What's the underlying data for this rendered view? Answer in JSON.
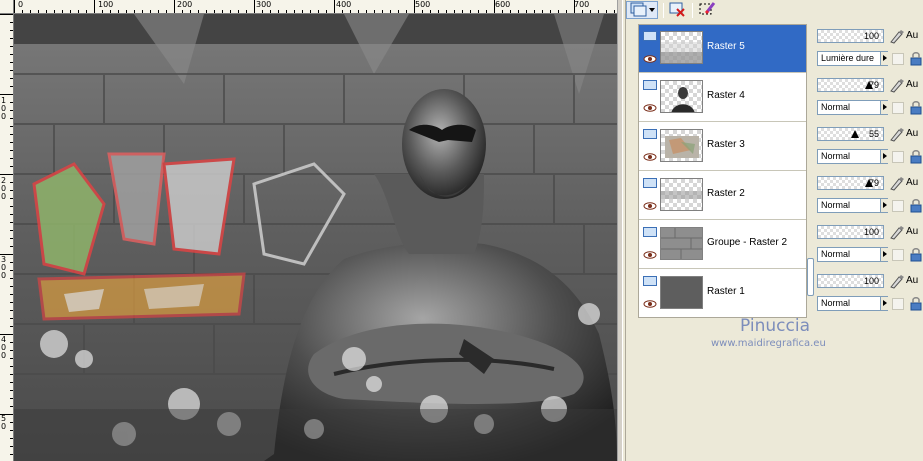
{
  "rulers": {
    "top_labels": [
      "0",
      "100",
      "200",
      "300",
      "400",
      "500",
      "600",
      "700"
    ],
    "left_labels": [
      "1\n0\n0",
      "2\n0\n0",
      "3\n0\n0",
      "4\n0\n0",
      "5\n0"
    ]
  },
  "toolbar": {
    "new_icon": "new-layer-icon",
    "delete_icon": "delete-layer-icon",
    "edit_icon": "edit-selection-icon"
  },
  "layers": [
    {
      "name": "Raster 5",
      "selected": true,
      "opacity": "100",
      "blend": "Lumière dure",
      "au": "Au"
    },
    {
      "name": "Raster 4",
      "selected": false,
      "opacity": "79",
      "blend": "Normal",
      "au": "Au"
    },
    {
      "name": "Raster 3",
      "selected": false,
      "opacity": "55",
      "blend": "Normal",
      "au": "Au"
    },
    {
      "name": "Raster 2",
      "selected": false,
      "opacity": "79",
      "blend": "Normal",
      "au": "Au"
    },
    {
      "name": "Groupe - Raster 2",
      "selected": false,
      "opacity": "100",
      "blend": "Normal",
      "au": "Au"
    },
    {
      "name": "Raster 1",
      "selected": false,
      "opacity": "100",
      "blend": "Normal",
      "au": "Au"
    }
  ],
  "watermark": {
    "title": "Pinuccia",
    "url": "www.maidiregrafica.eu"
  },
  "colors": {
    "selection": "#316ac5",
    "panel": "#ece9d8",
    "watermark": "#7c8dbb"
  }
}
